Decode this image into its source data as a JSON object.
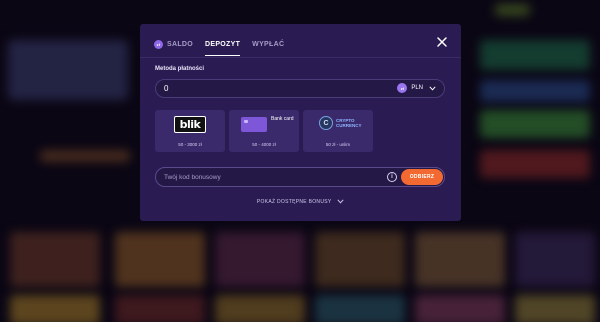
{
  "tabs": [
    {
      "label": "SALDO",
      "coin": "zł"
    },
    {
      "label": "DEPOZYT"
    },
    {
      "label": "WYPŁAĆ"
    }
  ],
  "payment": {
    "label": "Metoda płatności",
    "amount_value": "0",
    "currency": "PLN",
    "currency_coin": "zł"
  },
  "methods": [
    {
      "name": "blik",
      "range": "50 - 3000 zł"
    },
    {
      "name": "Bank card",
      "range": "50 - 4000 zł"
    },
    {
      "name": "CRYPTO CURRENCY",
      "range": "50 zł - unlim"
    }
  ],
  "bonus": {
    "placeholder": "Twój kod bonusowy",
    "apply_label": "ODBIERZ",
    "info_glyph": "i",
    "show_label": "POKAŻ DOSTĘPNE BONUSY"
  },
  "colors": {
    "modal_bg": "#2a1c52",
    "accent": "#f26a32",
    "card_bg": "#3a2a6c"
  }
}
